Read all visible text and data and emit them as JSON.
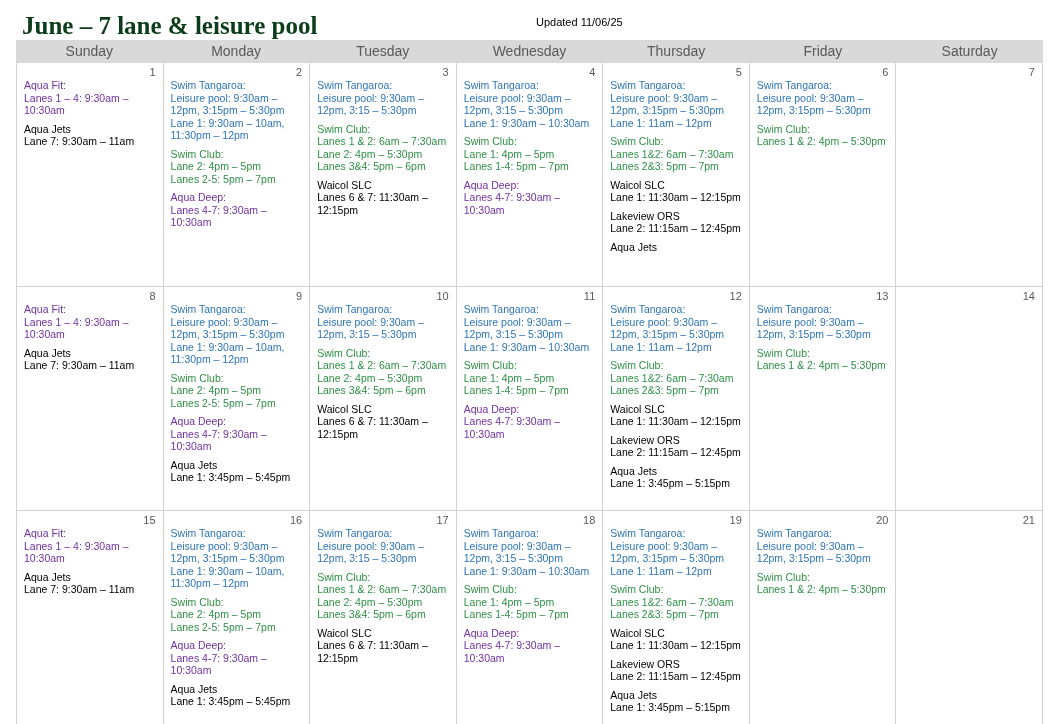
{
  "title": "June – 7 lane & leisure pool",
  "updated": "Updated 11/06/25",
  "weekdays": [
    "Sunday",
    "Monday",
    "Tuesday",
    "Wednesday",
    "Thursday",
    "Friday",
    "Saturday"
  ],
  "weeks": [
    [
      {
        "date": "1",
        "events": [
          {
            "title": "Aqua Fit:",
            "color": "#7030a0",
            "lines": [
              "Lanes 1 – 4: 9:30am – 10:30am"
            ]
          },
          {
            "title": "Aqua Jets",
            "lines": [
              "Lane 7: 9:30am – 11am"
            ]
          }
        ]
      },
      {
        "date": "2",
        "events": [
          {
            "title": "Swim Tangaroa:",
            "color": "#2e74b5",
            "lines": [
              "Leisure pool: 9:30am – 12pm, 3:15pm – 5:30pm",
              "Lane 1: 9:30am – 10am, 11:30pm – 12pm"
            ]
          },
          {
            "title": "Swim Club:",
            "color": "#2f8f46",
            "lines": [
              "Lane 2: 4pm – 5pm",
              "Lanes 2-5: 5pm – 7pm"
            ]
          },
          {
            "title": "Aqua Deep:",
            "color": "#7030a0",
            "lines": [
              "Lanes 4-7: 9:30am – 10:30am"
            ]
          }
        ]
      },
      {
        "date": "3",
        "events": [
          {
            "title": "Swim Tangaroa:",
            "color": "#2e74b5",
            "lines": [
              "Leisure pool: 9:30am – 12pm, 3:15 – 5:30pm"
            ]
          },
          {
            "title": "Swim Club:",
            "color": "#2f8f46",
            "lines": [
              "Lanes 1 & 2: 6am – 7:30am",
              "Lane 2: 4pm – 5:30pm",
              "Lanes 3&4: 5pm – 6pm"
            ]
          },
          {
            "title": "Waicol SLC",
            "lines": [
              "Lanes 6 & 7: 11:30am – 12:15pm"
            ]
          }
        ]
      },
      {
        "date": "4",
        "events": [
          {
            "title": "Swim Tangaroa:",
            "color": "#2e74b5",
            "lines": [
              "Leisure pool: 9:30am – 12pm, 3:15 – 5:30pm",
              "Lane 1: 9:30am – 10:30am"
            ]
          },
          {
            "title": "Swim Club:",
            "color": "#2f8f46",
            "lines": [
              "Lane 1: 4pm – 5pm",
              "Lanes 1-4: 5pm – 7pm"
            ]
          },
          {
            "title": "Aqua Deep:",
            "color": "#7030a0",
            "lines": [
              "Lanes 4-7: 9:30am – 10:30am"
            ]
          }
        ]
      },
      {
        "date": "5",
        "events": [
          {
            "title": "Swim Tangaroa:",
            "color": "#2e74b5",
            "lines": [
              "Leisure pool: 9:30am – 12pm, 3:15pm – 5:30pm",
              "Lane 1: 11am – 12pm"
            ]
          },
          {
            "title": "Swim Club:",
            "color": "#2f8f46",
            "lines": [
              "Lanes 1&2: 6am – 7:30am",
              "Lanes 2&3: 5pm – 7pm"
            ]
          },
          {
            "title": "Waicol SLC",
            "lines": [
              "Lane 1: 11:30am – 12:15pm"
            ]
          },
          {
            "title": "Lakeview ORS",
            "lines": [
              "Lane 2: 11:15am – 12:45pm"
            ]
          },
          {
            "title": "Aqua Jets"
          }
        ]
      },
      {
        "date": "6",
        "events": [
          {
            "title": "Swim Tangaroa:",
            "color": "#2e74b5",
            "lines": [
              "Leisure pool: 9:30am – 12pm, 3:15pm – 5:30pm"
            ]
          },
          {
            "title": "Swim Club:",
            "color": "#2f8f46",
            "lines": [
              "Lanes 1 & 2: 4pm – 5:30pm"
            ]
          }
        ]
      },
      {
        "date": "7"
      }
    ],
    [
      {
        "date": "8",
        "events": [
          {
            "title": "Aqua Fit:",
            "color": "#7030a0",
            "lines": [
              "Lanes 1 – 4: 9:30am – 10:30am"
            ]
          },
          {
            "title": "Aqua Jets",
            "lines": [
              "Lane 7: 9:30am – 11am"
            ]
          }
        ]
      },
      {
        "date": "9",
        "events": [
          {
            "title": "Swim Tangaroa:",
            "color": "#2e74b5",
            "lines": [
              "Leisure pool: 9:30am – 12pm, 3:15pm – 5:30pm",
              "Lane 1: 9:30am – 10am, 11:30pm – 12pm"
            ]
          },
          {
            "title": "Swim Club:",
            "color": "#2f8f46",
            "lines": [
              "Lane 2: 4pm – 5pm",
              "Lanes 2-5: 5pm – 7pm"
            ]
          },
          {
            "title": "Aqua Deep:",
            "color": "#7030a0",
            "lines": [
              "Lanes 4-7: 9:30am – 10:30am"
            ]
          },
          {
            "title": "Aqua Jets",
            "lines": [
              "Lane 1: 3:45pm – 5:45pm"
            ]
          }
        ]
      },
      {
        "date": "10",
        "events": [
          {
            "title": "Swim Tangaroa:",
            "color": "#2e74b5",
            "lines": [
              "Leisure pool: 9:30am – 12pm, 3:15 – 5:30pm"
            ]
          },
          {
            "title": "Swim Club:",
            "color": "#2f8f46",
            "lines": [
              "Lanes 1 & 2: 6am – 7:30am",
              "Lane 2: 4pm – 5:30pm",
              "Lanes 3&4: 5pm – 6pm"
            ]
          },
          {
            "title": "Waicol SLC",
            "lines": [
              "Lanes 6 & 7: 11:30am – 12:15pm"
            ]
          }
        ]
      },
      {
        "date": "11",
        "events": [
          {
            "title": "Swim Tangaroa:",
            "color": "#2e74b5",
            "lines": [
              "Leisure pool: 9:30am – 12pm, 3:15 – 5:30pm",
              "Lane 1: 9:30am – 10:30am"
            ]
          },
          {
            "title": "Swim Club:",
            "color": "#2f8f46",
            "lines": [
              "Lane 1: 4pm – 5pm",
              "Lanes 1-4: 5pm – 7pm"
            ]
          },
          {
            "title": "Aqua Deep:",
            "color": "#7030a0",
            "lines": [
              "Lanes 4-7: 9:30am – 10:30am"
            ]
          }
        ]
      },
      {
        "date": "12",
        "events": [
          {
            "title": "Swim Tangaroa:",
            "color": "#2e74b5",
            "lines": [
              "Leisure pool: 9:30am – 12pm, 3:15pm – 5:30pm",
              "Lane 1: 11am – 12pm"
            ]
          },
          {
            "title": "Swim Club:",
            "color": "#2f8f46",
            "lines": [
              "Lanes 1&2: 6am – 7:30am",
              "Lanes 2&3: 5pm – 7pm"
            ]
          },
          {
            "title": "Waicol SLC",
            "lines": [
              "Lane 1: 11:30am – 12:15pm"
            ]
          },
          {
            "title": "Lakeview ORS",
            "lines": [
              "Lane 2: 11:15am – 12:45pm"
            ]
          },
          {
            "title": "Aqua Jets",
            "lines": [
              "Lane 1: 3:45pm – 5:15pm"
            ]
          }
        ]
      },
      {
        "date": "13",
        "events": [
          {
            "title": "Swim Tangaroa:",
            "color": "#2e74b5",
            "lines": [
              "Leisure pool: 9:30am – 12pm, 3:15pm – 5:30pm"
            ]
          },
          {
            "title": "Swim Club:",
            "color": "#2f8f46",
            "lines": [
              "Lanes 1 & 2: 4pm – 5:30pm"
            ]
          }
        ]
      },
      {
        "date": "14"
      }
    ],
    [
      {
        "date": "15",
        "events": [
          {
            "title": "Aqua Fit:",
            "color": "#7030a0",
            "lines": [
              "Lanes 1 – 4: 9:30am – 10:30am"
            ]
          },
          {
            "title": "Aqua Jets",
            "lines": [
              "Lane 7: 9:30am – 11am"
            ]
          }
        ]
      },
      {
        "date": "16",
        "events": [
          {
            "title": "Swim Tangaroa:",
            "color": "#2e74b5",
            "lines": [
              "Leisure pool: 9:30am – 12pm, 3:15pm – 5:30pm",
              "Lane 1: 9:30am – 10am, 11:30pm – 12pm"
            ]
          },
          {
            "title": "Swim Club:",
            "color": "#2f8f46",
            "lines": [
              "Lane 2: 4pm – 5pm",
              "Lanes 2-5: 5pm – 7pm"
            ]
          },
          {
            "title": "Aqua Deep:",
            "color": "#7030a0",
            "lines": [
              "Lanes 4-7: 9:30am – 10:30am"
            ]
          },
          {
            "title": "Aqua Jets",
            "lines": [
              "Lane 1: 3:45pm – 5:45pm"
            ]
          }
        ]
      },
      {
        "date": "17",
        "events": [
          {
            "title": "Swim Tangaroa:",
            "color": "#2e74b5",
            "lines": [
              "Leisure pool: 9:30am – 12pm, 3:15 – 5:30pm"
            ]
          },
          {
            "title": "Swim Club:",
            "color": "#2f8f46",
            "lines": [
              "Lanes 1 & 2: 6am – 7:30am",
              "Lane 2: 4pm – 5:30pm",
              "Lanes 3&4: 5pm – 6pm"
            ]
          },
          {
            "title": "Waicol SLC",
            "lines": [
              "Lanes 6 & 7: 11:30am – 12:15pm"
            ]
          }
        ]
      },
      {
        "date": "18",
        "events": [
          {
            "title": "Swim Tangaroa:",
            "color": "#2e74b5",
            "lines": [
              "Leisure pool: 9:30am – 12pm, 3:15 – 5:30pm",
              "Lane 1: 9:30am – 10:30am"
            ]
          },
          {
            "title": "Swim Club:",
            "color": "#2f8f46",
            "lines": [
              "Lane 1: 4pm – 5pm",
              "Lanes 1-4: 5pm – 7pm"
            ]
          },
          {
            "title": "Aqua Deep:",
            "color": "#7030a0",
            "lines": [
              "Lanes 4-7: 9:30am – 10:30am"
            ]
          }
        ]
      },
      {
        "date": "19",
        "events": [
          {
            "title": "Swim Tangaroa:",
            "color": "#2e74b5",
            "lines": [
              "Leisure pool: 9:30am – 12pm, 3:15pm – 5:30pm",
              "Lane 1: 11am – 12pm"
            ]
          },
          {
            "title": "Swim Club:",
            "color": "#2f8f46",
            "lines": [
              "Lanes 1&2: 6am – 7:30am",
              "Lanes 2&3: 5pm – 7pm"
            ]
          },
          {
            "title": "Waicol SLC",
            "lines": [
              "Lane 1: 11:30am – 12:15pm"
            ]
          },
          {
            "title": "Lakeview ORS",
            "lines": [
              "Lane 2: 11:15am – 12:45pm"
            ]
          },
          {
            "title": "Aqua Jets",
            "lines": [
              "Lane 1: 3:45pm – 5:15pm"
            ]
          }
        ]
      },
      {
        "date": "20",
        "events": [
          {
            "title": "Swim Tangaroa:",
            "color": "#2e74b5",
            "lines": [
              "Leisure pool: 9:30am – 12pm, 3:15pm – 5:30pm"
            ]
          },
          {
            "title": "Swim Club:",
            "color": "#2f8f46",
            "lines": [
              "Lanes 1 & 2: 4pm – 5:30pm"
            ]
          }
        ]
      },
      {
        "date": "21"
      }
    ]
  ]
}
